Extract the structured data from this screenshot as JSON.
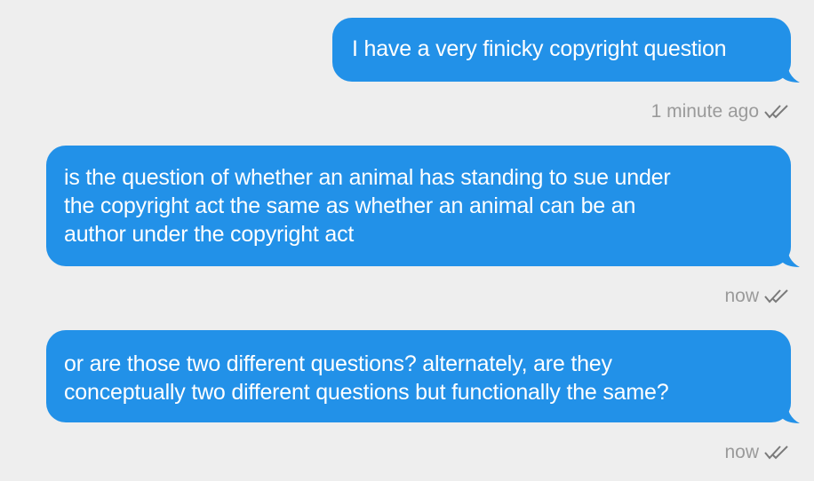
{
  "colors": {
    "background": "#eeeeee",
    "bubble": "#2291e8",
    "bubble_text": "#ffffff",
    "meta_text": "#9a9a9a"
  },
  "messages": [
    {
      "text": "I have a very finicky copyright question",
      "timestamp": "1 minute ago",
      "status_icon": "double-check-icon"
    },
    {
      "text": "is the question of whether an animal has standing to sue under\nthe copyright act the same as whether an animal can be an\nauthor under the copyright act",
      "timestamp": "now",
      "status_icon": "double-check-icon"
    },
    {
      "text": "or are those two different questions? alternately, are they\nconceptually two different questions but functionally the same?",
      "timestamp": "now",
      "status_icon": "double-check-icon"
    }
  ]
}
